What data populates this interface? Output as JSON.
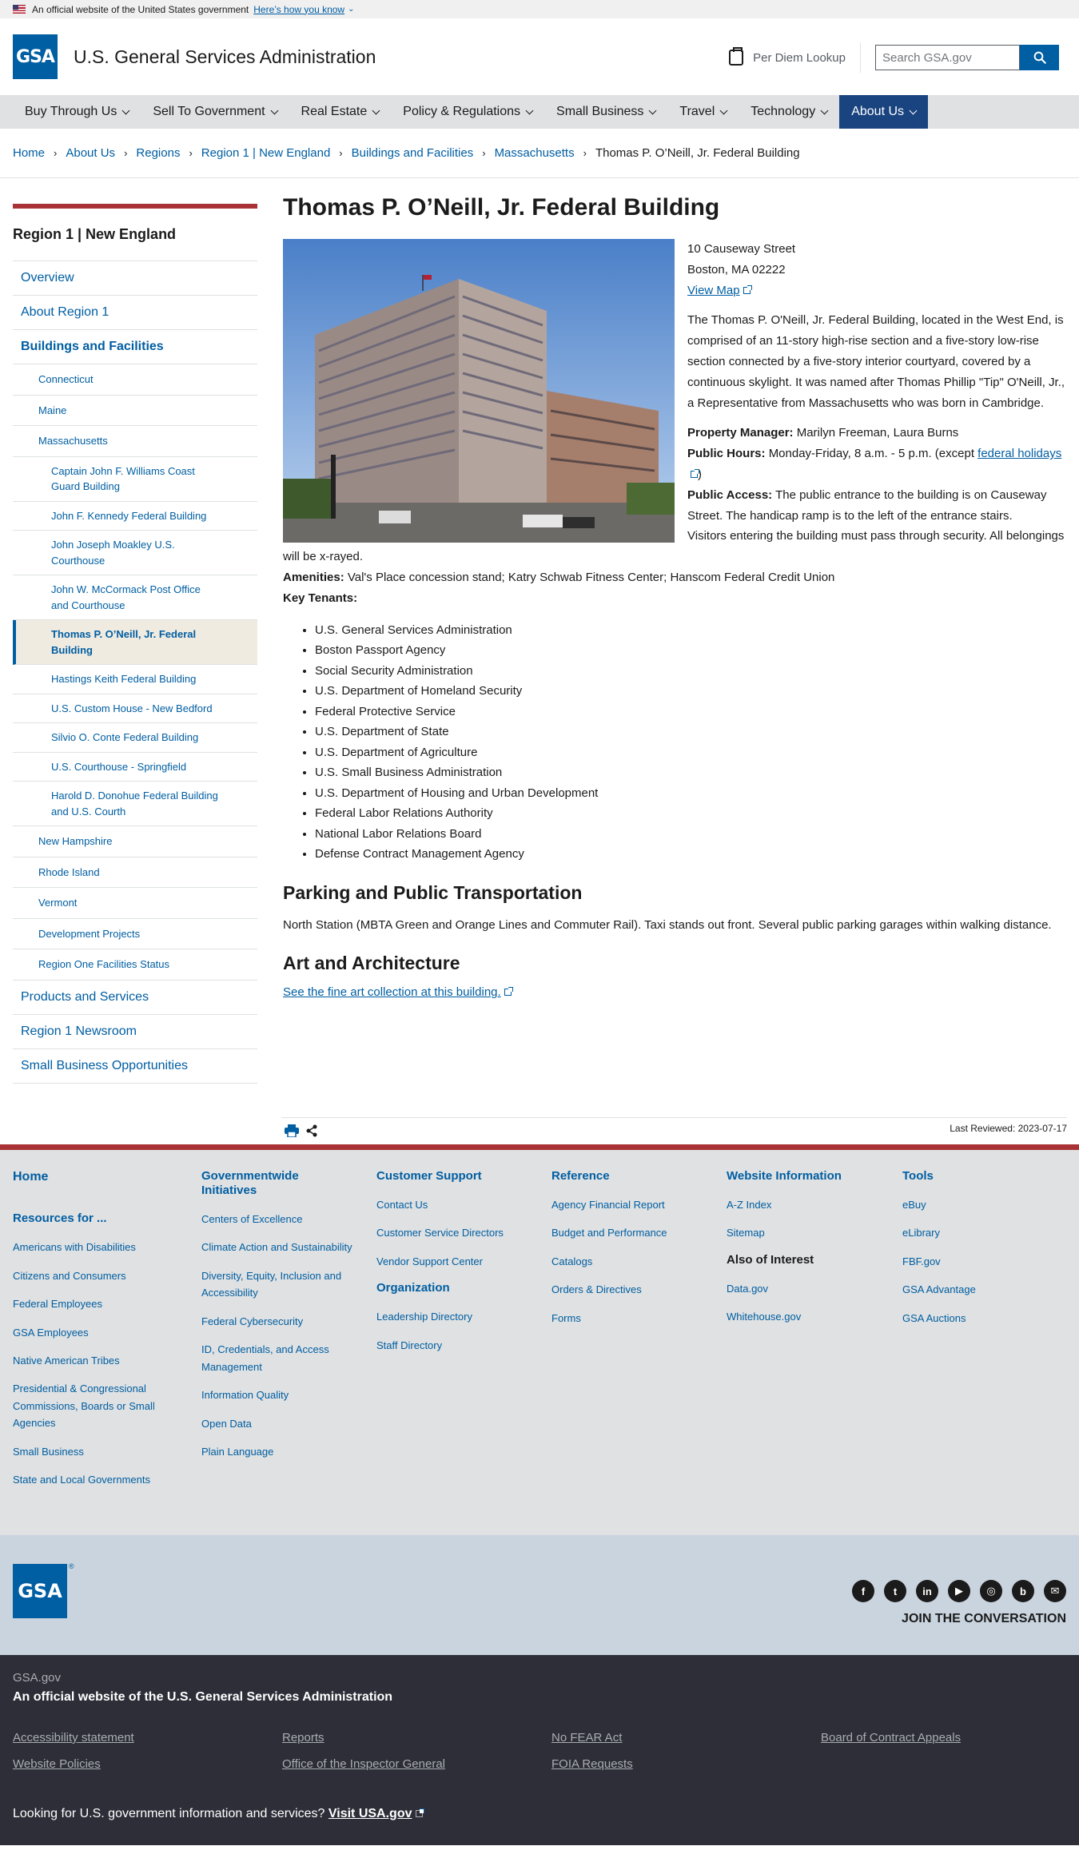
{
  "gov_banner": {
    "text": "An official website of the United States government",
    "link": "Here’s how you know"
  },
  "header": {
    "logo_text": "GSA",
    "site_title": "U.S. General Services Administration",
    "per_diem": "Per Diem Lookup",
    "search_placeholder": "Search GSA.gov"
  },
  "nav": [
    "Buy Through Us",
    "Sell To Government",
    "Real Estate",
    "Policy & Regulations",
    "Small Business",
    "Travel",
    "Technology",
    "About Us"
  ],
  "breadcrumb": [
    "Home",
    "About Us",
    "Regions",
    "Region 1 | New England",
    "Buildings and Facilities",
    "Massachusetts",
    "Thomas P. O’Neill, Jr. Federal Building"
  ],
  "sidenav": {
    "title": "Region 1 | New England",
    "items": [
      {
        "label": "Overview",
        "level": 1
      },
      {
        "label": "About Region 1",
        "level": 1
      },
      {
        "label": "Buildings and Facilities",
        "level": 1,
        "current": true
      },
      {
        "label": "Connecticut",
        "level": 2
      },
      {
        "label": "Maine",
        "level": 2
      },
      {
        "label": "Massachusetts",
        "level": 2
      },
      {
        "label": "Captain John F. Williams Coast Guard Building",
        "level": 3
      },
      {
        "label": "John F. Kennedy Federal Building",
        "level": 3
      },
      {
        "label": "John Joseph Moakley U.S. Courthouse",
        "level": 3
      },
      {
        "label": "John W. McCormack Post Office and Courthouse",
        "level": 3
      },
      {
        "label": "Thomas P. O’Neill, Jr. Federal Building",
        "level": 3,
        "current": true
      },
      {
        "label": "Hastings Keith Federal Building",
        "level": 3
      },
      {
        "label": "U.S. Custom House - New Bedford",
        "level": 3
      },
      {
        "label": "Silvio O. Conte Federal Building",
        "level": 3
      },
      {
        "label": "U.S. Courthouse - Springfield",
        "level": 3
      },
      {
        "label": "Harold D. Donohue Federal Building and U.S. Courth",
        "level": 3
      },
      {
        "label": "New Hampshire",
        "level": 2
      },
      {
        "label": "Rhode Island",
        "level": 2
      },
      {
        "label": "Vermont",
        "level": 2
      },
      {
        "label": "Development Projects",
        "level": 2
      },
      {
        "label": "Region One Facilities Status",
        "level": 2
      },
      {
        "label": "Products and Services",
        "level": 1
      },
      {
        "label": "Region 1 Newsroom",
        "level": 1
      },
      {
        "label": "Small Business Opportunities",
        "level": 1
      }
    ]
  },
  "content": {
    "title": "Thomas P. O’Neill, Jr. Federal Building",
    "address_1": "10 Causeway Street",
    "address_2": "Boston, MA 02222",
    "view_map": "View Map",
    "description": "The Thomas P. O'Neill, Jr. Federal Building, located in the West End, is comprised of an 11-story high-rise section and a five-story low-rise section connected by a five-story interior courtyard, covered by a continuous skylight. It was named after Thomas Phillip \"Tip\" O'Neill, Jr., a Representative from Massachusetts who was born in Cambridge.",
    "pm_label": "Property Manager:",
    "pm_value": "Marilyn Freeman, Laura Burns",
    "hours_label": "Public Hours:",
    "hours_value": "Monday-Friday, 8 a.m. - 5 p.m. (except",
    "hours_link": "federal holidays",
    "hours_close": ")",
    "access_label": "Public Access:",
    "access_value": "The public entrance to the building is on Causeway Street. The handicap ramp is to the left of the entrance stairs.",
    "visitors": "Visitors entering the building must pass through security. All belongings will be x-rayed.",
    "amenities_label": "Amenities:",
    "amenities_value": "Val's Place concession stand; Katry Schwab Fitness Center; Hanscom Federal Credit Union",
    "tenants_label": "Key Tenants:",
    "tenants": [
      "U.S. General Services Administration",
      "Boston Passport Agency",
      "Social Security Administration",
      "U.S. Department of Homeland Security",
      "Federal Protective Service",
      "U.S. Department of State",
      "U.S. Department of Agriculture",
      "U.S. Small Business Administration",
      "U.S. Department of Housing and Urban Development",
      "Federal Labor Relations Authority",
      "National Labor Relations Board",
      "Defense Contract Management Agency"
    ],
    "parking_title": "Parking and Public Transportation",
    "parking_text": "North Station (MBTA Green and Orange Lines and Commuter Rail). Taxi stands out front. Several public parking garages within walking distance.",
    "art_title": "Art and Architecture",
    "art_link": "See the fine art collection at this building.",
    "last_reviewed": "Last Reviewed: 2023-07-17"
  },
  "footer": {
    "home": "Home",
    "resources_title": "Resources for ...",
    "resources": [
      "Americans with Disabilities",
      "Citizens and Consumers",
      "Federal Employees",
      "GSA Employees",
      "Native American Tribes",
      "Presidential & Congressional Commissions, Boards or Small Agencies",
      "Small Business",
      "State and Local Governments"
    ],
    "govwide_title": "Governmentwide Initiatives",
    "govwide": [
      "Centers of Excellence",
      "Climate Action and Sustainability",
      "Diversity, Equity, Inclusion and Accessibility",
      "Federal Cybersecurity",
      "ID, Credentials, and Access Management",
      "Information Quality",
      "Open Data",
      "Plain Language"
    ],
    "support_title": "Customer Support",
    "support": [
      "Contact Us",
      "Customer Service Directors",
      "Vendor Support Center"
    ],
    "org_title": "Organization",
    "org": [
      "Leadership Directory",
      "Staff Directory"
    ],
    "reference_title": "Reference",
    "reference": [
      "Agency Financial Report",
      "Budget and Performance",
      "Catalogs",
      "Orders & Directives",
      "Forms"
    ],
    "webinfo_title": "Website Information",
    "webinfo": [
      "A-Z Index",
      "Sitemap"
    ],
    "interest_title": "Also of Interest",
    "interest": [
      "Data.gov",
      "Whitehouse.gov"
    ],
    "tools_title": "Tools",
    "tools": [
      "eBuy",
      "eLibrary",
      "FBF.gov",
      "GSA Advantage",
      "GSA Auctions"
    ],
    "join": "JOIN THE CONVERSATION",
    "logo_text": "GSA",
    "reg": "®",
    "domain": "GSA.gov",
    "official": "An official website of the U.S. General Services Administration",
    "identifier_links": [
      "Accessibility statement",
      "Reports",
      "No FEAR Act",
      "Board of Contract Appeals",
      "Website Policies",
      "Office of the Inspector General",
      "FOIA Requests"
    ],
    "usa_text": "Looking for U.S. government information and services?",
    "usa_link": "Visit USA.gov"
  },
  "colors": {
    "primary": "#005ea2",
    "nav_active": "#1a4480",
    "accent_red": "#a83235"
  }
}
